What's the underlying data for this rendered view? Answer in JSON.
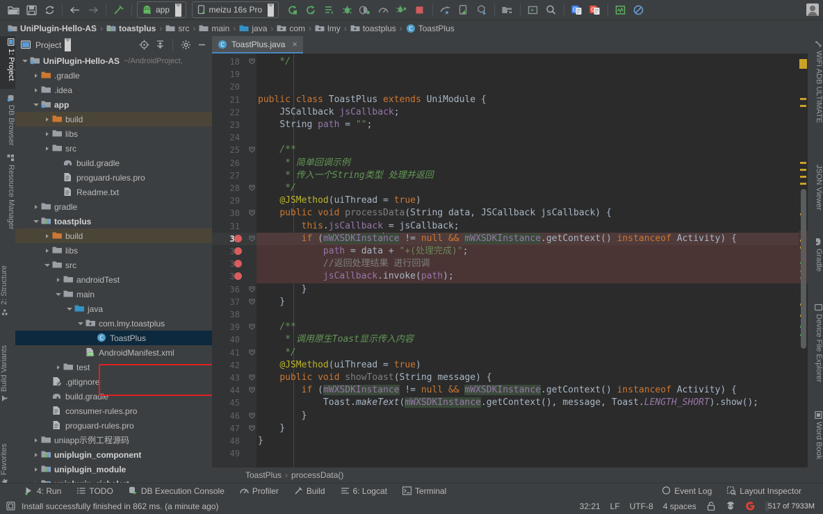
{
  "toolbar": {
    "icons_left": [
      "open-folder-icon",
      "save-icon",
      "sync-icon",
      "back-arrow-icon",
      "forward-arrow-icon",
      "build-hammer-icon"
    ],
    "run_config": {
      "label": "app",
      "icon": "android-robot-icon"
    },
    "device": {
      "label": "meizu 16s Pro",
      "icon": "phone-icon"
    },
    "icons_right": [
      "run-icon",
      "run-coverage-icon",
      "apply-changes-icon",
      "debug-icon",
      "attach-debugger-icon",
      "profiler-icon",
      "run-with-config-icon",
      "stop-icon",
      "sdk-manager-icon",
      "avd-manager-icon",
      "sdk-download-icon",
      "project-structure-icon",
      "layout-editor-icon",
      "search-icon",
      "translate-blue-icon",
      "translate-red-icon",
      "monitor-icon",
      "no-entry-icon"
    ],
    "avatar": "user-avatar"
  },
  "breadcrumb": {
    "items": [
      {
        "label": "UniPlugin-Hello-AS",
        "icon": "module-android-icon",
        "bold": true
      },
      {
        "label": "toastplus",
        "icon": "module-library-icon",
        "bold": true
      },
      {
        "label": "src",
        "icon": "folder-icon",
        "bold": false
      },
      {
        "label": "main",
        "icon": "folder-icon",
        "bold": false
      },
      {
        "label": "java",
        "icon": "folder-source-icon",
        "bold": false
      },
      {
        "label": "com",
        "icon": "package-icon",
        "bold": false
      },
      {
        "label": "lmy",
        "icon": "package-icon",
        "bold": false
      },
      {
        "label": "toastplus",
        "icon": "package-icon",
        "bold": false
      },
      {
        "label": "ToastPlus",
        "icon": "class-icon",
        "bold": false
      }
    ],
    "separator": "›"
  },
  "left_stripe": {
    "top_items": [
      {
        "label": "1: Project",
        "icon": "project-icon",
        "selected": true
      },
      {
        "label": "DB Browser",
        "icon": "db-browser-icon",
        "selected": false
      },
      {
        "label": "Resource Manager",
        "icon": "resource-manager-icon",
        "selected": false
      }
    ],
    "bottom_items": [
      {
        "label": "2: Structure",
        "icon": "structure-icon"
      },
      {
        "label": "Build Variants",
        "icon": "build-variants-icon"
      },
      {
        "label": "Favorites",
        "icon": "favorites-icon"
      }
    ]
  },
  "right_stripe": {
    "items": [
      {
        "label": "WIFI ADB ULTIMATE",
        "icon": "wifi-adb-icon"
      },
      {
        "label": "JSON Viewer",
        "icon": "json-viewer-icon"
      },
      {
        "label": "Gradle",
        "icon": "gradle-elephant-icon"
      },
      {
        "label": "Device File Explorer",
        "icon": "device-file-explorer-icon"
      },
      {
        "label": "Word Book",
        "icon": "word-book-icon"
      }
    ]
  },
  "project_panel": {
    "title": "Project",
    "header_icons": [
      "locate-icon",
      "collapse-all-icon",
      "settings-gear-icon",
      "hide-icon"
    ],
    "tree": [
      {
        "depth": 0,
        "label": "UniPlugin-Hello-AS",
        "sub": "~/AndroidProject,",
        "icon": "module-android-icon",
        "arrow": "open",
        "bold": true,
        "state": "none"
      },
      {
        "depth": 1,
        "label": ".gradle",
        "icon": "folder-excluded-icon",
        "arrow": "closed",
        "bold": false,
        "state": "none"
      },
      {
        "depth": 1,
        "label": ".idea",
        "icon": "folder-icon",
        "arrow": "closed",
        "bold": false,
        "state": "none"
      },
      {
        "depth": 1,
        "label": "app",
        "icon": "module-android-icon",
        "arrow": "open",
        "bold": true,
        "state": "none"
      },
      {
        "depth": 2,
        "label": "build",
        "icon": "folder-excluded-icon",
        "arrow": "closed",
        "bold": false,
        "state": "highlight"
      },
      {
        "depth": 2,
        "label": "libs",
        "icon": "folder-icon",
        "arrow": "closed",
        "bold": false,
        "state": "none"
      },
      {
        "depth": 2,
        "label": "src",
        "icon": "folder-icon",
        "arrow": "closed",
        "bold": false,
        "state": "none"
      },
      {
        "depth": 3,
        "label": "build.gradle",
        "icon": "gradle-file-icon",
        "arrow": "none",
        "bold": false,
        "state": "none"
      },
      {
        "depth": 3,
        "label": "proguard-rules.pro",
        "icon": "text-file-icon",
        "arrow": "none",
        "bold": false,
        "state": "none"
      },
      {
        "depth": 3,
        "label": "Readme.txt",
        "icon": "text-file-icon",
        "arrow": "none",
        "bold": false,
        "state": "none"
      },
      {
        "depth": 1,
        "label": "gradle",
        "icon": "folder-icon",
        "arrow": "closed",
        "bold": false,
        "state": "none"
      },
      {
        "depth": 1,
        "label": "toastplus",
        "icon": "module-library-icon",
        "arrow": "open",
        "bold": true,
        "state": "none"
      },
      {
        "depth": 2,
        "label": "build",
        "icon": "folder-excluded-icon",
        "arrow": "closed",
        "bold": false,
        "state": "highlight"
      },
      {
        "depth": 2,
        "label": "libs",
        "icon": "folder-icon",
        "arrow": "closed",
        "bold": false,
        "state": "none"
      },
      {
        "depth": 2,
        "label": "src",
        "icon": "folder-icon",
        "arrow": "open",
        "bold": false,
        "state": "none"
      },
      {
        "depth": 3,
        "label": "androidTest",
        "icon": "folder-icon",
        "arrow": "closed",
        "bold": false,
        "state": "none"
      },
      {
        "depth": 3,
        "label": "main",
        "icon": "folder-icon",
        "arrow": "open",
        "bold": false,
        "state": "none"
      },
      {
        "depth": 4,
        "label": "java",
        "icon": "folder-source-icon",
        "arrow": "open",
        "bold": false,
        "state": "none"
      },
      {
        "depth": 5,
        "label": "com.lmy.toastplus",
        "icon": "package-icon",
        "arrow": "open",
        "bold": false,
        "state": "none"
      },
      {
        "depth": 6,
        "label": "ToastPlus",
        "icon": "class-icon",
        "arrow": "none",
        "bold": false,
        "state": "selected"
      },
      {
        "depth": 5,
        "label": "AndroidManifest.xml",
        "icon": "manifest-icon",
        "arrow": "none",
        "bold": false,
        "state": "none"
      },
      {
        "depth": 3,
        "label": "test",
        "icon": "folder-icon",
        "arrow": "closed",
        "bold": false,
        "state": "none"
      },
      {
        "depth": 2,
        "label": ".gitignore",
        "icon": "gitignore-icon",
        "arrow": "none",
        "bold": false,
        "state": "none"
      },
      {
        "depth": 2,
        "label": "build.gradle",
        "icon": "gradle-file-icon",
        "arrow": "none",
        "bold": false,
        "state": "none"
      },
      {
        "depth": 2,
        "label": "consumer-rules.pro",
        "icon": "text-file-icon",
        "arrow": "none",
        "bold": false,
        "state": "none"
      },
      {
        "depth": 2,
        "label": "proguard-rules.pro",
        "icon": "text-file-icon",
        "arrow": "none",
        "bold": false,
        "state": "none"
      },
      {
        "depth": 1,
        "label": "uniapp示例工程源码",
        "icon": "folder-icon",
        "arrow": "closed",
        "bold": false,
        "state": "none"
      },
      {
        "depth": 1,
        "label": "uniplugin_component",
        "icon": "module-library-icon",
        "arrow": "closed",
        "bold": true,
        "state": "none"
      },
      {
        "depth": 1,
        "label": "uniplugin_module",
        "icon": "module-library-icon",
        "arrow": "closed",
        "bold": true,
        "state": "none"
      },
      {
        "depth": 1,
        "label": "uniplugin_richalert",
        "icon": "module-library-icon",
        "arrow": "closed",
        "bold": true,
        "state": "none"
      }
    ],
    "annotation": {
      "type": "red-rectangle-highlight",
      "color": "#e02020",
      "targets": [
        "com.lmy.toastplus",
        "ToastPlus"
      ]
    }
  },
  "editor": {
    "tab": {
      "label": "ToastPlus.java",
      "icon": "class-icon",
      "close": "×"
    },
    "first_line_number": 18,
    "current_line": 32,
    "breakpoint_lines": [
      32,
      33,
      34,
      35
    ],
    "highlight_lines": [
      32,
      33,
      34,
      35
    ],
    "fold_lines": [
      18,
      25,
      28,
      30,
      32,
      36,
      37,
      39,
      41,
      43,
      44,
      46,
      47
    ],
    "breadcrumb": [
      "ToastPlus",
      "processData()"
    ],
    "lines": [
      {
        "n": 18,
        "t": "    */"
      },
      {
        "n": 19,
        "t": ""
      },
      {
        "n": 20,
        "t": ""
      },
      {
        "n": 21,
        "t": "public class ToastPlus extends UniModule {"
      },
      {
        "n": 22,
        "t": "    JSCallback jsCallback;"
      },
      {
        "n": 23,
        "t": "    String path = \"\";"
      },
      {
        "n": 24,
        "t": ""
      },
      {
        "n": 25,
        "t": "    /**"
      },
      {
        "n": 26,
        "t": "     * 简单回调示例"
      },
      {
        "n": 27,
        "t": "     * 传入一个String类型 处理并返回"
      },
      {
        "n": 28,
        "t": "     */"
      },
      {
        "n": 29,
        "t": "    @JSMethod(uiThread = true)"
      },
      {
        "n": 30,
        "t": "    public void processData(String data, JSCallback jsCallback) {"
      },
      {
        "n": 31,
        "t": "        this.jsCallback = jsCallback;"
      },
      {
        "n": 32,
        "t": "        if (mWXSDKInstance != null && mWXSDKInstance.getContext() instanceof Activity) {"
      },
      {
        "n": 33,
        "t": "            path = data + \"+(处理完成)\";"
      },
      {
        "n": 34,
        "t": "            //返回处理结果 进行回调"
      },
      {
        "n": 35,
        "t": "            jsCallback.invoke(path);"
      },
      {
        "n": 36,
        "t": "        }"
      },
      {
        "n": 37,
        "t": "    }"
      },
      {
        "n": 38,
        "t": ""
      },
      {
        "n": 39,
        "t": "    /**"
      },
      {
        "n": 40,
        "t": "     * 调用原生Toast显示传入内容"
      },
      {
        "n": 41,
        "t": "     */"
      },
      {
        "n": 42,
        "t": "    @JSMethod(uiThread = true)"
      },
      {
        "n": 43,
        "t": "    public void showToast(String message) {"
      },
      {
        "n": 44,
        "t": "        if (mWXSDKInstance != null && mWXSDKInstance.getContext() instanceof Activity) {"
      },
      {
        "n": 45,
        "t": "            Toast.makeText(mWXSDKInstance.getContext(), message, Toast.LENGTH_SHORT).show();"
      },
      {
        "n": 46,
        "t": "        }"
      },
      {
        "n": 47,
        "t": "    }"
      },
      {
        "n": 48,
        "t": "}"
      },
      {
        "n": 49,
        "t": ""
      }
    ]
  },
  "bottom_tool_windows": [
    {
      "label": "4: Run",
      "mnemonic": "4",
      "icon": "run-green-icon"
    },
    {
      "label": "TODO",
      "mnemonic": "",
      "icon": "todo-list-icon"
    },
    {
      "label": "DB Execution Console",
      "mnemonic": "",
      "icon": "db-console-icon"
    },
    {
      "label": "Profiler",
      "mnemonic": "",
      "icon": "profiler-icon"
    },
    {
      "label": "Build",
      "mnemonic": "",
      "icon": "build-hammer-icon"
    },
    {
      "label": "6: Logcat",
      "mnemonic": "6",
      "icon": "logcat-icon"
    },
    {
      "label": "Terminal",
      "mnemonic": "",
      "icon": "terminal-icon"
    }
  ],
  "bottom_right_tool_windows": [
    {
      "label": "Event Log",
      "icon": "event-log-icon"
    },
    {
      "label": "Layout Inspector",
      "icon": "layout-inspector-icon"
    }
  ],
  "status_bar": {
    "message": "Install successfully finished in 862 ms. (a minute ago)",
    "message_icon": "notification-icon",
    "caret_position": "32:21",
    "line_separator": "LF",
    "encoding": "UTF-8",
    "indent": "4 spaces",
    "lock_icon": "unlocked-icon",
    "inspection_icon": "hector-inspector-icon",
    "google_icon": "google-icon",
    "memory": "517 of 7933M",
    "memory_percent": 6.5
  },
  "colors": {
    "background": "#3c3f41",
    "editor_bg": "#2b2b2b",
    "gutter_bg": "#313335",
    "accent_blue": "#4a88c7",
    "selection_blue": "#0d293e",
    "highlight_block": "#4a3434",
    "breakpoint_red": "#db5c5c",
    "annotation_red": "#e02020",
    "folder_orange": "#cc7832",
    "keyword_orange": "#cc7832",
    "string_green": "#6a8759",
    "comment_green": "#629755",
    "annotation_yellow": "#bbb529",
    "field_purple": "#9876aa",
    "method_yellow": "#ffc66d",
    "marker_yellow": "#c9a227"
  }
}
